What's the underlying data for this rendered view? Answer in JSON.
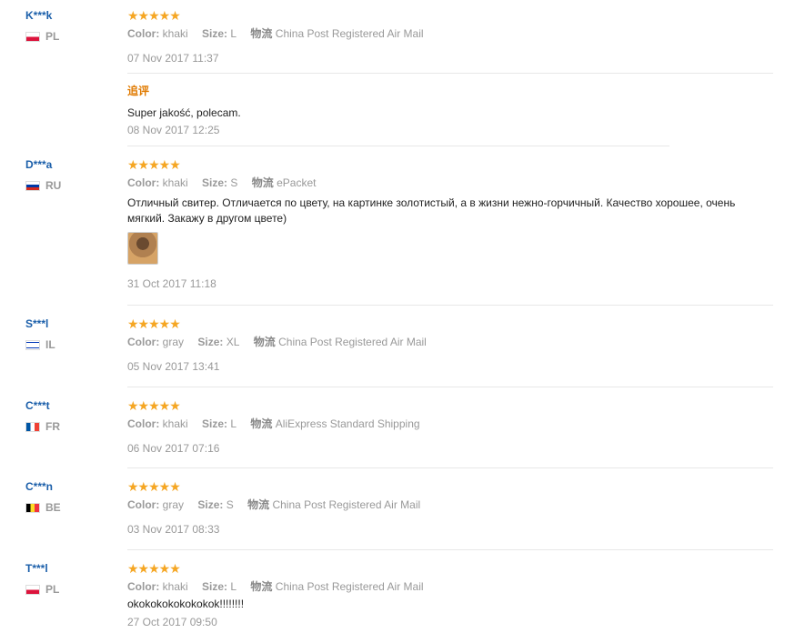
{
  "labels": {
    "color": "Color:",
    "size": "Size:",
    "shipping": "物流"
  },
  "star_color": "#f5a623",
  "reviews": [
    {
      "user": "K***k",
      "country": "PL",
      "flag": "poland-flag-icon",
      "rating": 5,
      "color": "khaki",
      "size": "L",
      "shipping": "China Post Registered Air Mail",
      "date": "07 Nov 2017 11:37",
      "additional": {
        "title": "追评",
        "text": "Super jakość, polecam.",
        "date": "08 Nov 2017 12:25"
      }
    },
    {
      "user": "D***a",
      "country": "RU",
      "flag": "russia-flag-icon",
      "rating": 5,
      "color": "khaki",
      "size": "S",
      "shipping": "ePacket",
      "text": "Отличный свитер. Отличается по цвету, на картинке золотистый, а в жизни нежно-горчичный. Качество хорошее, очень мягкий. Закажу в другом цвете)",
      "photo": "review-photo-thumbnail",
      "date": "31 Oct 2017 11:18"
    },
    {
      "user": "S***l",
      "country": "IL",
      "flag": "israel-flag-icon",
      "rating": 5,
      "color": "gray",
      "size": "XL",
      "shipping": "China Post Registered Air Mail",
      "date": "05 Nov 2017 13:41"
    },
    {
      "user": "C***t",
      "country": "FR",
      "flag": "france-flag-icon",
      "rating": 5,
      "color": "khaki",
      "size": "L",
      "shipping": "AliExpress Standard Shipping",
      "date": "06 Nov 2017 07:16"
    },
    {
      "user": "C***n",
      "country": "BE",
      "flag": "belgium-flag-icon",
      "rating": 5,
      "color": "gray",
      "size": "S",
      "shipping": "China Post Registered Air Mail",
      "date": "03 Nov 2017 08:33"
    },
    {
      "user": "T***l",
      "country": "PL",
      "flag": "poland-flag-icon",
      "rating": 5,
      "color": "khaki",
      "size": "L",
      "shipping": "China Post Registered Air Mail",
      "text": "okokokokokokokok!!!!!!!!",
      "date": "27 Oct 2017 09:50"
    }
  ]
}
